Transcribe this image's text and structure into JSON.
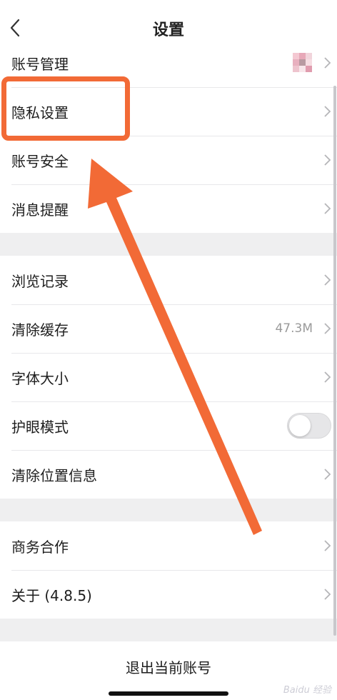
{
  "header": {
    "title": "设置"
  },
  "group1": [
    {
      "label": "账号管理"
    },
    {
      "label": "隐私设置"
    },
    {
      "label": "账号安全"
    },
    {
      "label": "消息提醒"
    }
  ],
  "group2": [
    {
      "label": "浏览记录"
    },
    {
      "label": "清除缓存",
      "value": "47.3M"
    },
    {
      "label": "字体大小"
    },
    {
      "label": "护眼模式",
      "toggle_on": false
    },
    {
      "label": "清除位置信息"
    }
  ],
  "group3": [
    {
      "label": "商务合作"
    },
    {
      "label": "关于 (4.8.5)"
    }
  ],
  "logout": {
    "label": "退出当前账号"
  },
  "watermark": {
    "text": "Baidu 经验"
  },
  "colors": {
    "annotation": "#f26a36",
    "toggle_off": "#e6e6e8",
    "background": "#efeff0"
  }
}
